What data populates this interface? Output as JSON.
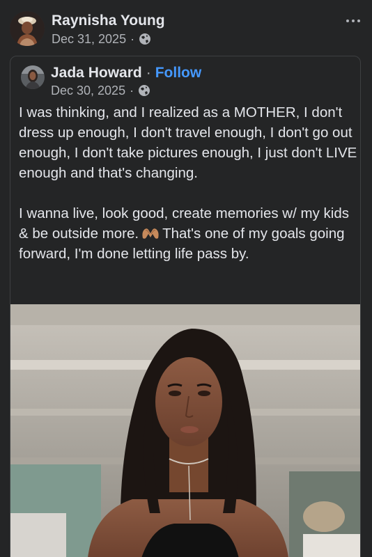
{
  "post": {
    "author": "Raynisha Young",
    "date": "Dec 31, 2025",
    "separator": "·",
    "privacy_icon": "globe-icon",
    "more_icon": "more-horizontal-icon"
  },
  "shared_post": {
    "author": "Jada Howard",
    "separator": "·",
    "follow_label": "Follow",
    "date": "Dec 30, 2025",
    "privacy_icon": "globe-icon",
    "paragraph_1": "I was thinking, and I realized as a MOTHER, I don't dress up enough, I don't travel enough, I don't go out enough, I don't take pictures enough, I just don't LIVE enough and that's changing.",
    "paragraph_2_a": "I wanna live, look good, create memories w/ my kids & be outside more.",
    "paragraph_2_emoji": "heart-hands-emoji",
    "paragraph_2_b": "That's one of my goals going forward, I'm done letting life pass by.",
    "photo": "woman-portrait-photo"
  },
  "colors": {
    "background": "#242526",
    "text_primary": "#e4e6eb",
    "text_secondary": "#b0b3b8",
    "link": "#4599ff",
    "card_border": "#3e4042"
  }
}
